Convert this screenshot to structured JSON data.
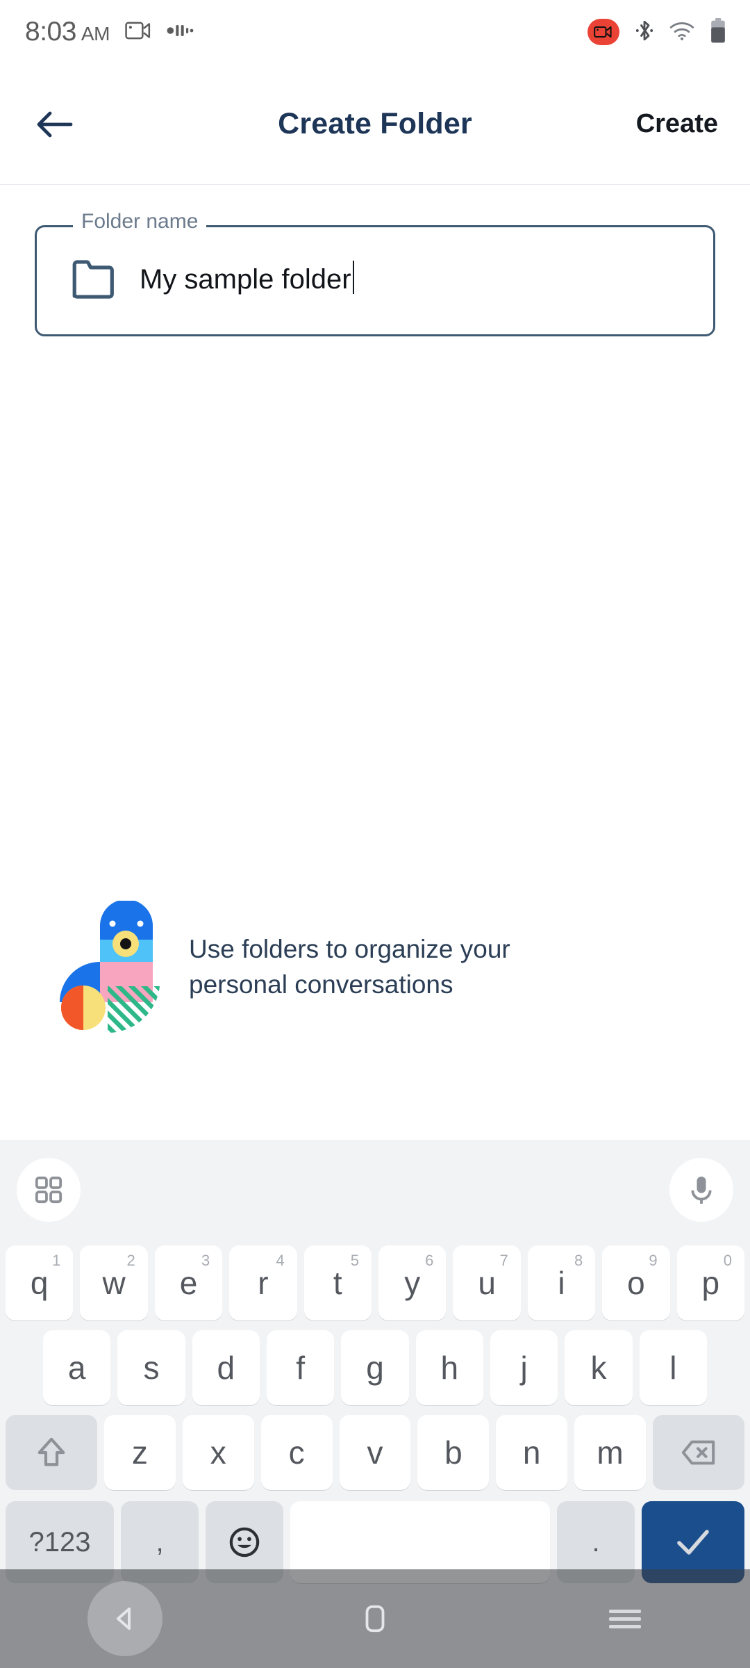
{
  "status_bar": {
    "time": "8:03",
    "ampm": "AM",
    "icons": [
      "screen-record-icon",
      "notification-bars-icon",
      "recording-badge-icon",
      "bluetooth-icon",
      "wifi-icon",
      "battery-icon"
    ],
    "battery_level": "60",
    "recording_color": "#ea4335"
  },
  "app_bar": {
    "back_label": "back-arrow",
    "title": "Create Folder",
    "action_label": "Create",
    "title_color": "#1d3557"
  },
  "form": {
    "field_label": "Folder name",
    "field_value": "My sample folder",
    "field_placeholder": "Folder name",
    "field_icon": "folder-icon",
    "border_color": "#3e5a73",
    "caret_visible": "true"
  },
  "empty_state": {
    "message_line_1": "Use folders to organize your",
    "message_line_2": "personal conversations",
    "illustration": "abstract-bird-illustration",
    "colors": {
      "blue": "#1a73e8",
      "light_blue": "#4fc3f7",
      "pink": "#f8a6c0",
      "yellow": "#f7e07a",
      "orange": "#f2572a",
      "green": "#2eb88a",
      "dark": "#141414"
    }
  },
  "keyboard": {
    "toolbar": {
      "left_icon": "grid-apps-icon",
      "right_icon": "microphone-icon"
    },
    "row_1": [
      {
        "key": "q",
        "sup": "1"
      },
      {
        "key": "w",
        "sup": "2"
      },
      {
        "key": "e",
        "sup": "3"
      },
      {
        "key": "r",
        "sup": "4"
      },
      {
        "key": "t",
        "sup": "5"
      },
      {
        "key": "y",
        "sup": "6"
      },
      {
        "key": "u",
        "sup": "7"
      },
      {
        "key": "i",
        "sup": "8"
      },
      {
        "key": "o",
        "sup": "9"
      },
      {
        "key": "p",
        "sup": "0"
      }
    ],
    "row_2": [
      {
        "key": "a"
      },
      {
        "key": "s"
      },
      {
        "key": "d"
      },
      {
        "key": "f"
      },
      {
        "key": "g"
      },
      {
        "key": "h"
      },
      {
        "key": "j"
      },
      {
        "key": "k"
      },
      {
        "key": "l"
      }
    ],
    "row_3": [
      {
        "key": "z"
      },
      {
        "key": "x"
      },
      {
        "key": "c"
      },
      {
        "key": "v"
      },
      {
        "key": "b"
      },
      {
        "key": "n"
      },
      {
        "key": "m"
      }
    ],
    "shift_label": "shift-icon",
    "backspace_label": "backspace-icon",
    "row_4": {
      "symbols_label": "?123",
      "comma_label": ",",
      "emoji_label": "emoji-icon",
      "space_label": "",
      "period_label": ".",
      "enter_label": "check-icon",
      "enter_color": "#1b4e8c"
    }
  },
  "nav_bar": {
    "back_label": "nav-back-icon",
    "home_label": "nav-home-icon",
    "recents_label": "nav-recents-icon"
  }
}
